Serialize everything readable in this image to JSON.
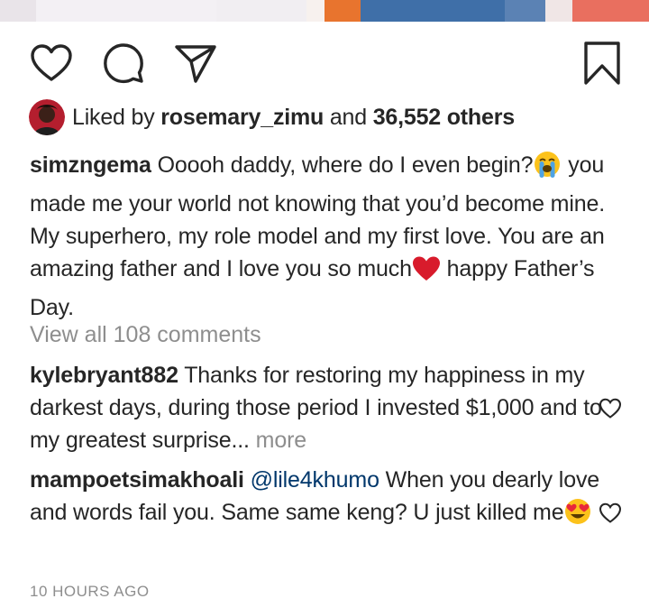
{
  "post": {
    "liked_by": {
      "prefix": "Liked by",
      "user": "rosemary_zimu",
      "conjunction": "and",
      "others": "36,552 others"
    },
    "caption": {
      "username": "simzngema",
      "line1": "Ooooh daddy, where do I even begin?",
      "body": "you made me your world not knowing that you’d become mine. My superhero, my role model and my first love. You are an amazing father and I love you so much",
      "ending": " happy Father’s Day."
    },
    "view_all_comments": "View all 108 comments",
    "comments": [
      {
        "username": "kylebryant882",
        "text": "Thanks for restoring my happiness in my darkest days, during those period I invested $1,000 and to my greatest surprise...",
        "more": "more"
      },
      {
        "username": "mampoetsimakhoali",
        "mention": "@lile4khumo",
        "text": "When you dearly love and words fail you. Same same keng? U just killed me"
      }
    ],
    "timestamp": "10 HOURS AGO"
  },
  "icons": {
    "like": "heart-outline-icon",
    "comment": "speech-bubble-icon",
    "share": "paper-plane-icon",
    "save": "bookmark-icon",
    "crying_emoji": "loudly-crying-face-emoji",
    "red_heart_emoji": "red-heart-emoji",
    "heart_eyes_emoji": "smiling-face-heart-eyes-emoji"
  },
  "colors": {
    "text": "#262626",
    "muted": "#8e8e8e",
    "mention": "#00376b",
    "heart": "#d81b2c"
  }
}
